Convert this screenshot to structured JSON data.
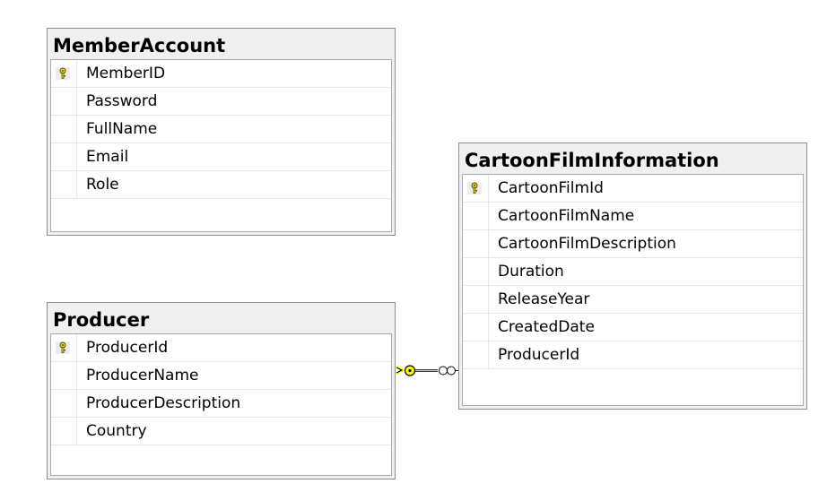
{
  "tables": [
    {
      "name": "MemberAccount",
      "columns": [
        {
          "name": "MemberID",
          "primary_key": true
        },
        {
          "name": "Password",
          "primary_key": false
        },
        {
          "name": "FullName",
          "primary_key": false
        },
        {
          "name": "Email",
          "primary_key": false
        },
        {
          "name": "Role",
          "primary_key": false
        }
      ]
    },
    {
      "name": "Producer",
      "columns": [
        {
          "name": "ProducerId",
          "primary_key": true
        },
        {
          "name": "ProducerName",
          "primary_key": false
        },
        {
          "name": "ProducerDescription",
          "primary_key": false
        },
        {
          "name": "Country",
          "primary_key": false
        }
      ]
    },
    {
      "name": "CartoonFilmInformation",
      "columns": [
        {
          "name": "CartoonFilmId",
          "primary_key": true
        },
        {
          "name": "CartoonFilmName",
          "primary_key": false
        },
        {
          "name": "CartoonFilmDescription",
          "primary_key": false
        },
        {
          "name": "Duration",
          "primary_key": false
        },
        {
          "name": "ReleaseYear",
          "primary_key": false
        },
        {
          "name": "CreatedDate",
          "primary_key": false
        },
        {
          "name": "ProducerId",
          "primary_key": false
        }
      ]
    }
  ],
  "relationships": [
    {
      "from_table": "Producer",
      "from_end": "one",
      "to_table": "CartoonFilmInformation",
      "to_end": "many"
    }
  ],
  "colors": {
    "key_icon": "#e8d21d",
    "relationship_line": "#000000",
    "relationship_highlight": "#ffff00"
  },
  "icons": {
    "primary_key": "key-icon",
    "one_end": "key-icon",
    "many_end": "infinity-icon"
  }
}
